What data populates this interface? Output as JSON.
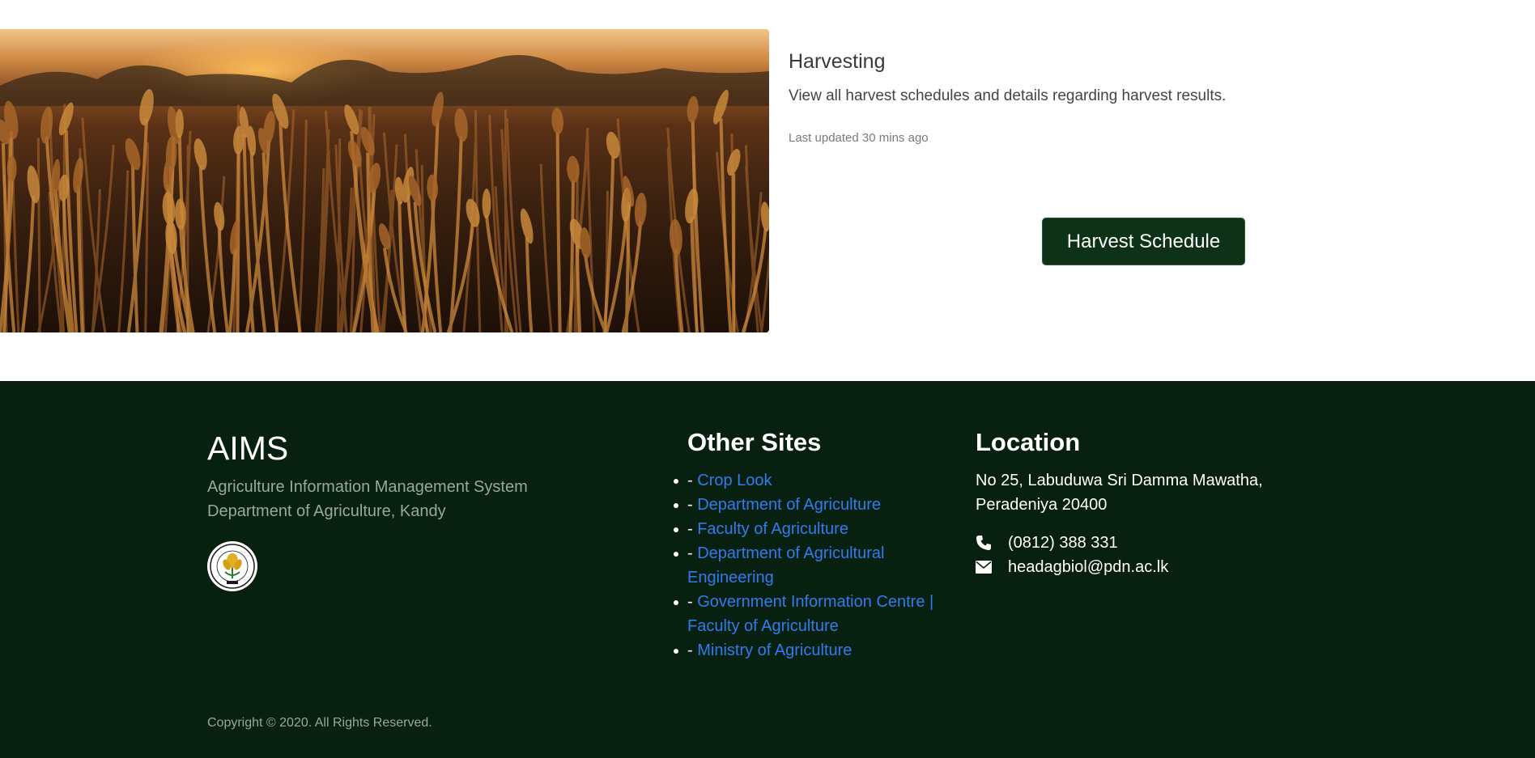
{
  "card": {
    "image_alt": "wheat field at sunset",
    "title": "Harvesting",
    "text": "View all harvest schedules and details regarding harvest results.",
    "updated": "Last updated 30 mins ago",
    "button_label": "Harvest Schedule"
  },
  "footer": {
    "brand": {
      "title": "AIMS",
      "line1": "Agriculture Information Management System",
      "line2": "Department of Agriculture, Kandy"
    },
    "other_sites": {
      "heading": "Other Sites",
      "prefix": "- ",
      "items": [
        {
          "label": "Crop Look"
        },
        {
          "label": "Department of Agriculture"
        },
        {
          "label": "Faculty of Agriculture"
        },
        {
          "label": "Department of Agricultural Engineering"
        },
        {
          "label": "Government Information Centre | Faculty of Agriculture"
        },
        {
          "label": "Ministry of Agriculture"
        }
      ]
    },
    "location": {
      "heading": "Location",
      "address_line1": "No 25, Labuduwa Sri Damma Mawatha,",
      "address_line2": "Peradeniya 20400",
      "phone": "(0812) 388 331",
      "email": "headagbiol@pdn.ac.lk",
      "phone_icon": "phone-icon",
      "email_icon": "envelope-icon"
    },
    "copyright": "Copyright © 2020. All Rights Reserved."
  },
  "colors": {
    "footer_bg": "#082010",
    "button_bg": "#0e3217",
    "link": "#2f7bf0",
    "muted_text": "#9aa79c"
  }
}
